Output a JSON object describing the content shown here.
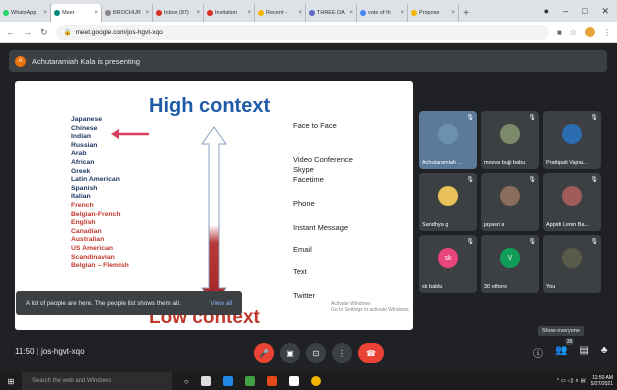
{
  "tabs": [
    {
      "label": "WhatsApp",
      "color": "#25d366",
      "active": false
    },
    {
      "label": "Meet",
      "color": "#00897b",
      "active": true
    },
    {
      "label": "BROCHUR",
      "color": "#888888",
      "active": false
    },
    {
      "label": "Inbox (87)",
      "color": "#d93025",
      "active": false
    },
    {
      "label": "Invitation",
      "color": "#d93025",
      "active": false
    },
    {
      "label": "Recent -",
      "color": "#f4b400",
      "active": false
    },
    {
      "label": "THREE DA",
      "color": "#5c6bc0",
      "active": false
    },
    {
      "label": "vote of th",
      "color": "#4285f4",
      "active": false
    },
    {
      "label": "Propose",
      "color": "#f4b400",
      "active": false
    }
  ],
  "browser": {
    "url": "meet.google.com/jos-hgvt-xqo"
  },
  "presenting": {
    "initial": "A",
    "text": "Achutaramiah Kala is presenting"
  },
  "slide": {
    "title": "High context",
    "bottom_title": "Low context",
    "cultures": [
      {
        "name": "Japanese",
        "color": "#1f3864"
      },
      {
        "name": "Chinese",
        "color": "#1f3864"
      },
      {
        "name": "Indian",
        "color": "#1f3864"
      },
      {
        "name": "Russian",
        "color": "#1f3864"
      },
      {
        "name": "Arab",
        "color": "#1f3864"
      },
      {
        "name": "African",
        "color": "#1f3864"
      },
      {
        "name": "Greek",
        "color": "#1f3864"
      },
      {
        "name": "Latin American",
        "color": "#1f3864"
      },
      {
        "name": "Spanish",
        "color": "#1f3864"
      },
      {
        "name": "Italian",
        "color": "#1f3864"
      },
      {
        "name": "French",
        "color": "#c0392b"
      },
      {
        "name": "Belgian-French",
        "color": "#c0392b"
      },
      {
        "name": "English",
        "color": "#c0392b"
      },
      {
        "name": "Canadian",
        "color": "#c0392b"
      },
      {
        "name": "Australian",
        "color": "#c0392b"
      },
      {
        "name": "US American",
        "color": "#c0392b"
      },
      {
        "name": "Scandinavian",
        "color": "#c0392b"
      },
      {
        "name": "Belgian – Flemish",
        "color": "#c0392b"
      }
    ],
    "media": [
      "Face to Face",
      "Video Conference",
      "Skype",
      "Facetime",
      "Phone",
      "Instant Message",
      "Email",
      "Text",
      "Twitter"
    ],
    "watermark_line1": "Activate Windows",
    "watermark_line2": "Go to Settings to activate Windows."
  },
  "participants": [
    {
      "name": "Achutaramiah ...",
      "color": "#6d8fb0",
      "highlight": true
    },
    {
      "name": "movva bujji babu",
      "color": "#7c8a6a",
      "highlight": false
    },
    {
      "name": "Prattipati Vajrai...",
      "color": "#2b6cb0",
      "highlight": false
    },
    {
      "name": "Sandhya g",
      "color": "#e8c15a",
      "highlight": false
    },
    {
      "name": "jayasri a",
      "color": "#8a6d5a",
      "highlight": false
    },
    {
      "name": "Appidi Lenin Ba...",
      "color": "#a05a5a",
      "highlight": false
    },
    {
      "name": "sk bablu",
      "initial": "sk",
      "color": "#e8457a",
      "highlight": false
    },
    {
      "name": "30 others",
      "initial": "V",
      "color": "#0f9d58",
      "highlight": false
    },
    {
      "name": "You",
      "color": "#5a5a4a",
      "highlight": false
    }
  ],
  "toast": {
    "text": "A lot of people are here. The people list shows them all.",
    "link": "View all"
  },
  "tooltip": "Show everyone",
  "meeting": {
    "time": "11:50",
    "code": "jos-hgvt-xqo",
    "participant_count": "39"
  },
  "taskbar": {
    "search_placeholder": "Search the web and Windows",
    "time": "11:50 AM",
    "date": "5/27/2021"
  }
}
